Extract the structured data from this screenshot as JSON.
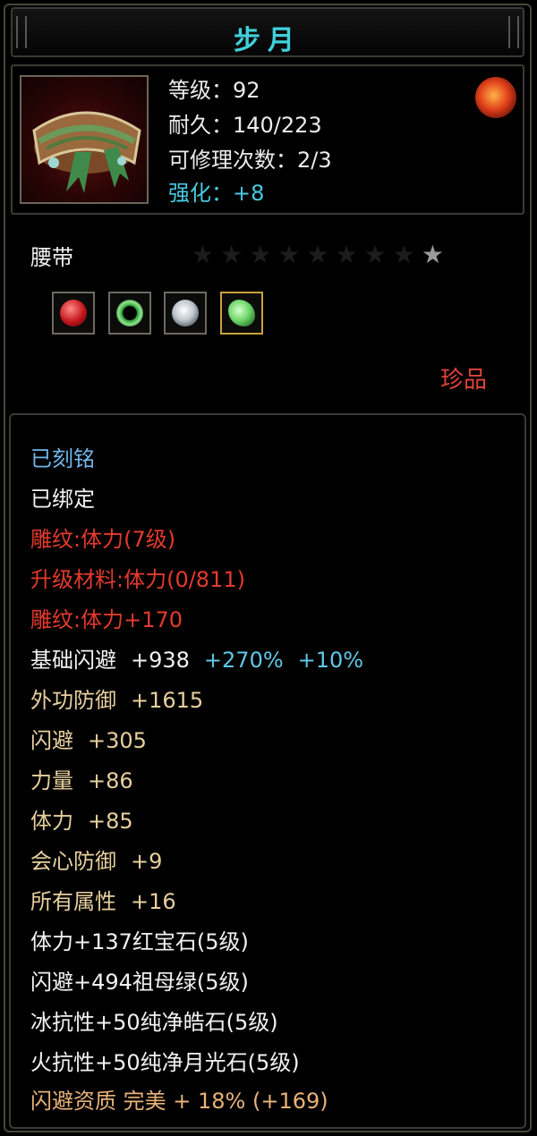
{
  "title": "步月",
  "info": {
    "level": "等级：92",
    "durability": "耐久：140/223",
    "repairs": "可修理次数：2/3",
    "enhance": "强化：+8"
  },
  "item": {
    "slot_type": "腰带",
    "stars_total": 9,
    "stars_lit": 1,
    "gems": [
      {
        "name": "ruby-gem-icon",
        "color": "#c3151a"
      },
      {
        "name": "emerald-ring-icon",
        "color": "#2f9c3c"
      },
      {
        "name": "diamond-gem-icon",
        "color": "#bfc7cf"
      },
      {
        "name": "jade-gem-icon",
        "color": "#6fd76a"
      }
    ],
    "rarity": "珍品"
  },
  "attrs": {
    "engraved": "已刻铭",
    "bound": "已绑定",
    "carve1": "雕纹:体力(7级)",
    "upgrade": "升级材料:体力(0/811)",
    "carve2": "雕纹:体力+170",
    "base_dodge": {
      "label": "基础闪避",
      "v1": "+938",
      "v2": "+270%",
      "v3": "+10%"
    },
    "ext_def": {
      "label": "外功防御",
      "v": "+1615"
    },
    "dodge": {
      "label": "闪避",
      "v": "+305"
    },
    "strength": {
      "label": "力量",
      "v": "+86"
    },
    "stamina": {
      "label": "体力",
      "v": "+85"
    },
    "crit_def": {
      "label": "会心防御",
      "v": "+9"
    },
    "all_attr": {
      "label": "所有属性",
      "v": "+16"
    },
    "gem1": "体力+137红宝石(5级)",
    "gem2": "闪避+494祖母绿(5级)",
    "gem3": "冰抗性+50纯净皓石(5级)",
    "gem4": "火抗性+50纯净月光石(5级)",
    "aptitude": "闪避资质 完美 + 18% (+169)"
  }
}
